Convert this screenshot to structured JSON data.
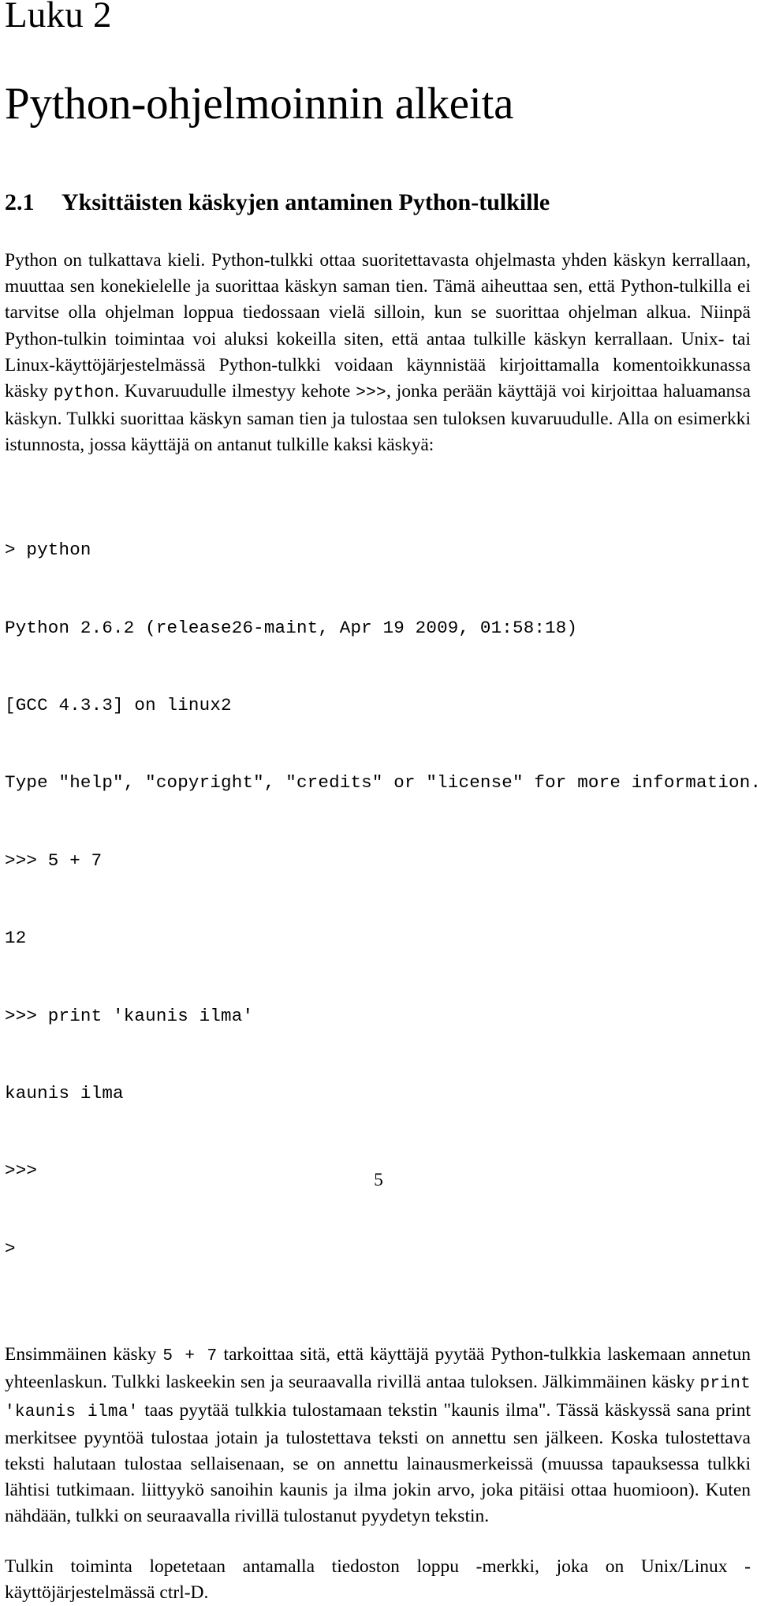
{
  "chapter": {
    "label": "Luku 2",
    "title": "Python-ohjelmoinnin alkeita"
  },
  "section": {
    "number": "2.1",
    "title": "Yksittäisten käskyjen antaminen Python-tulkille"
  },
  "paragraphs": {
    "intro": {
      "t1": "Python on tulkattava kieli. Python-tulkki ottaa suoritettavasta ohjelmasta yhden käskyn kerrallaan, muuttaa sen konekielelle ja suorittaa käskyn saman tien. Tämä aiheuttaa sen, että Python-tulkilla ei tarvitse olla ohjelman loppua tiedossaan vielä silloin, kun se suorittaa ohjelman alkua. Niinpä Python-tulkin toimintaa voi aluksi kokeilla siten, että antaa tulkille käskyn kerrallaan. Unix- tai Linux-käyttöjärjestelmässä Python-tulkki voidaan käynnistää kirjoittamalla komentoikkunassa käsky ",
      "code1": "python",
      "t2": ". Kuvaruudulle ilmestyy kehote ",
      "code2": ">>>",
      "t3": ", jonka perään käyttäjä voi kirjoittaa haluamansa käskyn. Tulkki suorittaa käskyn saman tien ja tulostaa sen tuloksen kuvaruudulle. Alla on esimerkki istunnosta, jossa käyttäjä on antanut tulkille kaksi käskyä:"
    },
    "explain": {
      "t1": "Ensimmäinen käsky ",
      "code1": "5 + 7",
      "t2": " tarkoittaa sitä, että käyttäjä pyytää Python-tulkkia laskemaan annetun yhteenlaskun. Tulkki laskeekin sen ja seuraavalla rivillä antaa tuloksen. Jälkimmäinen käsky ",
      "code2": "print 'kaunis ilma'",
      "t3": " taas pyytää tulkkia tulostamaan tekstin \"kaunis ilma\". Tässä käskyssä sana print merkitsee pyyntöä tulostaa jotain ja tulostettava teksti on annettu sen jälkeen. Koska tulostettava teksti halutaan tulostaa sellaisenaan, se on annettu lainausmerkeissä (muussa tapauksessa tulkki lähtisi tutkimaan. liittyykö sanoihin kaunis ja ilma jokin arvo, joka pitäisi ottaa huomioon). Kuten nähdään, tulkki on seuraavalla rivillä tulostanut pyydetyn tekstin."
    },
    "closing": {
      "t1": "Tulkin toiminta lopetetaan antamalla tiedoston loppu -merkki, joka on Unix/Linux -käyttöjärjestelmässä ctrl-D."
    }
  },
  "code_block": {
    "lines": [
      "> python",
      "Python 2.6.2 (release26-maint, Apr 19 2009, 01:58:18)",
      "[GCC 4.3.3] on linux2",
      "Type \"help\", \"copyright\", \"credits\" or \"license\" for more information.",
      ">>> 5 + 7",
      "12",
      ">>> print 'kaunis ilma'",
      "kaunis ilma",
      ">>>",
      ">"
    ]
  },
  "footer": {
    "page_number": "5"
  }
}
